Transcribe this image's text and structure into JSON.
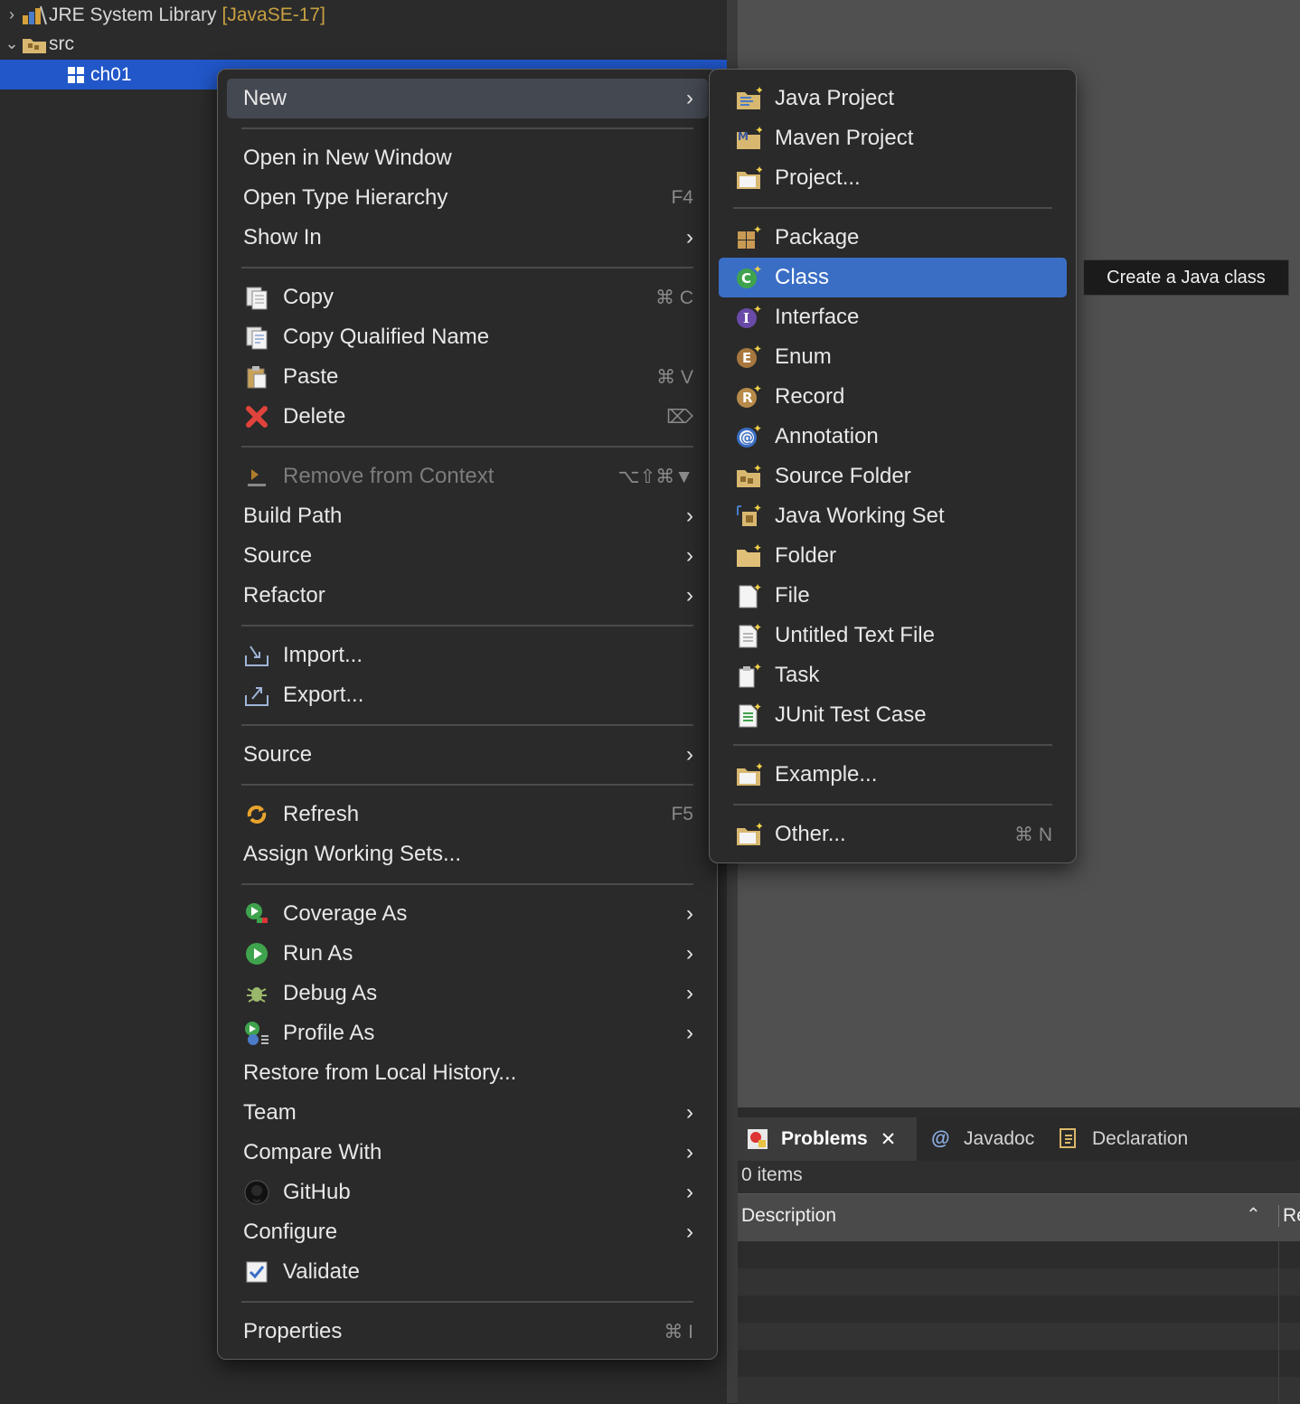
{
  "explorer": {
    "rows": [
      {
        "name": "JRE System Library",
        "suffix": "[JavaSE-17]",
        "expand": "›"
      },
      {
        "name": "src",
        "expand": "⌄"
      },
      {
        "name": "ch01"
      }
    ]
  },
  "context_menu": {
    "items": [
      {
        "label": "New",
        "submenu": true
      },
      {
        "label": "Open in New Window"
      },
      {
        "label": "Open Type Hierarchy",
        "shortcut": "F4"
      },
      {
        "label": "Show In",
        "submenu": true
      },
      {
        "label": "Copy",
        "shortcut": "⌘ C"
      },
      {
        "label": "Copy Qualified Name"
      },
      {
        "label": "Paste",
        "shortcut": "⌘ V"
      },
      {
        "label": "Delete",
        "shortcut": "⌦"
      },
      {
        "label": "Remove from Context",
        "shortcut": "⌥⇧⌘▼",
        "disabled": true
      },
      {
        "label": "Build Path",
        "submenu": true
      },
      {
        "label": "Source",
        "submenu": true
      },
      {
        "label": "Refactor",
        "submenu": true
      },
      {
        "label": "Import..."
      },
      {
        "label": "Export..."
      },
      {
        "label": "Source",
        "submenu": true
      },
      {
        "label": "Refresh",
        "shortcut": "F5"
      },
      {
        "label": "Assign Working Sets..."
      },
      {
        "label": "Coverage As",
        "submenu": true
      },
      {
        "label": "Run As",
        "submenu": true
      },
      {
        "label": "Debug As",
        "submenu": true
      },
      {
        "label": "Profile As",
        "submenu": true
      },
      {
        "label": "Restore from Local History..."
      },
      {
        "label": "Team",
        "submenu": true
      },
      {
        "label": "Compare With",
        "submenu": true
      },
      {
        "label": "GitHub",
        "submenu": true
      },
      {
        "label": "Configure",
        "submenu": true
      },
      {
        "label": "Validate"
      },
      {
        "label": "Properties",
        "shortcut": "⌘ I"
      }
    ]
  },
  "new_submenu": {
    "items": [
      {
        "label": "Java Project"
      },
      {
        "label": "Maven Project"
      },
      {
        "label": "Project..."
      },
      {
        "label": "Package"
      },
      {
        "label": "Class",
        "selected": true
      },
      {
        "label": "Interface"
      },
      {
        "label": "Enum"
      },
      {
        "label": "Record"
      },
      {
        "label": "Annotation"
      },
      {
        "label": "Source Folder"
      },
      {
        "label": "Java Working Set"
      },
      {
        "label": "Folder"
      },
      {
        "label": "File"
      },
      {
        "label": "Untitled Text File"
      },
      {
        "label": "Task"
      },
      {
        "label": "JUnit Test Case"
      },
      {
        "label": "Example..."
      },
      {
        "label": "Other...",
        "shortcut": "⌘ N"
      }
    ]
  },
  "tooltip": "Create a Java class",
  "problems": {
    "tabs": [
      {
        "label": "Problems",
        "close": "✕"
      },
      {
        "label": "Javadoc"
      },
      {
        "label": "Declaration"
      }
    ],
    "items_count": "0 items",
    "columns": [
      "Description",
      "Re"
    ],
    "sort_indicator": "⌃"
  },
  "colors": {
    "selection": "#3a6ec5",
    "tree_selection": "#2157c9",
    "menu_bg": "#2a2a2a",
    "menu_highlight": "#444851"
  }
}
